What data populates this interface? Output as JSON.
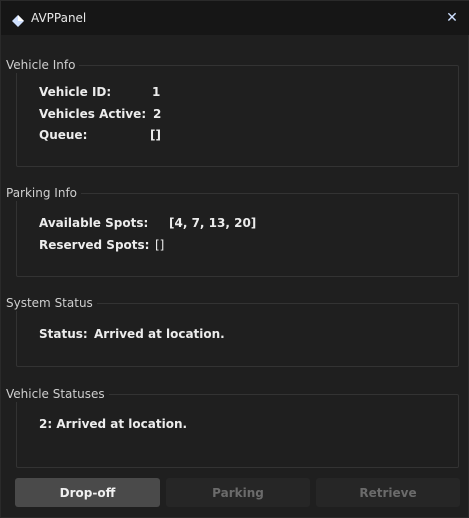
{
  "window": {
    "title": "AVPPanel",
    "close_glyph": "✕"
  },
  "vehicle_info": {
    "label": "Vehicle Info",
    "vehicle_id_key": "Vehicle ID:",
    "vehicle_id_value": "1",
    "vehicles_active_key": "Vehicles Active:",
    "vehicles_active_value": "2",
    "queue_key": "Queue:",
    "queue_value": "[]"
  },
  "parking_info": {
    "label": "Parking Info",
    "available_key": "Available Spots:",
    "available_value": "[4, 7, 13, 20]",
    "reserved_key": "Reserved Spots:",
    "reserved_value": "[]"
  },
  "system_status": {
    "label": "System Status",
    "status_key": "Status:",
    "status_value": "Arrived at location."
  },
  "vehicle_statuses": {
    "label": "Vehicle Statuses",
    "entry": "2: Arrived at location."
  },
  "buttons": {
    "dropoff": "Drop-off",
    "parking": "Parking",
    "retrieve": "Retrieve"
  },
  "colors": {
    "accent_icon": "#cfe0ff",
    "background": "#1f1f1f",
    "active_button": "#4a4a4a",
    "disabled_button": "#262626"
  },
  "icons": {
    "title": "diamond-icon",
    "close": "close-icon"
  }
}
